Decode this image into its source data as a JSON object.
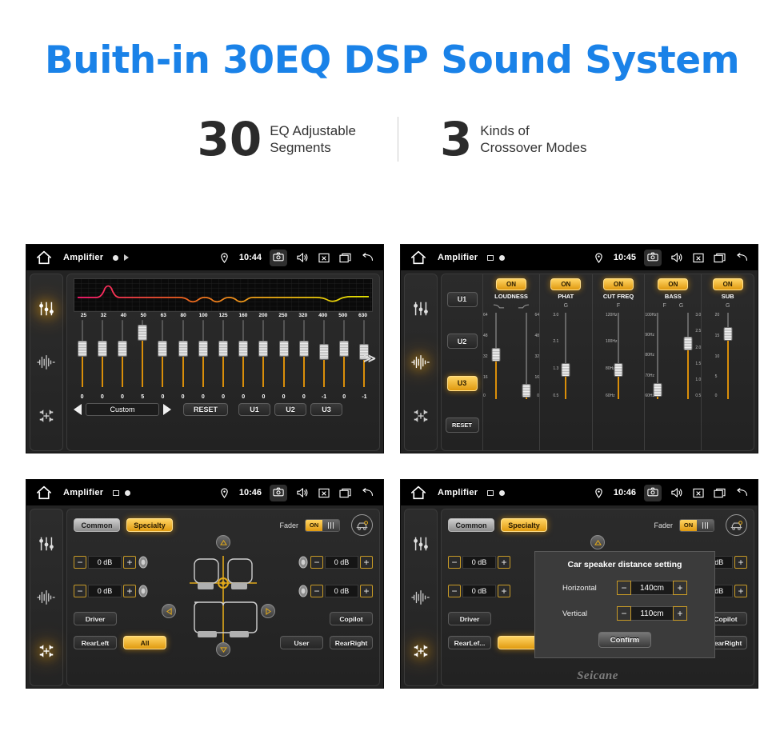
{
  "hero": {
    "title": "Buith-in 30EQ DSP Sound System",
    "stats": [
      {
        "number": "30",
        "line1": "EQ Adjustable",
        "line2": "Segments"
      },
      {
        "number": "3",
        "line1": "Kinds of",
        "line2": "Crossover Modes"
      }
    ]
  },
  "colors": {
    "title_blue": "#1a82e8",
    "amber": "#e09a10",
    "amber_light": "#ffd463",
    "panel_bg": "#232323",
    "statusbar_bg": "#000000"
  },
  "panels": [
    {
      "id": "eq-panel",
      "statusbar": {
        "title": "Amplifier",
        "time": "10:44",
        "icons": [
          "home-icon",
          "record-dot-icon",
          "play-icon",
          "location-pin-icon",
          "camera-icon",
          "volume-icon",
          "close-box-icon",
          "recent-apps-icon",
          "back-arrow-icon"
        ]
      },
      "rail": [
        {
          "icon": "eq-sliders-icon",
          "active": true
        },
        {
          "icon": "waveform-icon",
          "active": false
        },
        {
          "icon": "speaker-balance-icon",
          "active": false
        }
      ],
      "eq": {
        "frequencies": [
          "25",
          "32",
          "40",
          "50",
          "63",
          "80",
          "100",
          "125",
          "160",
          "200",
          "250",
          "320",
          "400",
          "500",
          "630"
        ],
        "values": [
          "0",
          "0",
          "0",
          "5",
          "0",
          "0",
          "0",
          "0",
          "0",
          "0",
          "0",
          "0",
          "-1",
          "0",
          "-1"
        ],
        "preset": "Custom",
        "reset_label": "RESET",
        "user_presets": [
          "U1",
          "U2",
          "U3"
        ],
        "next_label": "≫",
        "prev_arrow": "left-arrow-icon",
        "next_arrow": "right-arrow-icon"
      }
    },
    {
      "id": "crossover-panel",
      "statusbar": {
        "title": "Amplifier",
        "time": "10:45",
        "icons": [
          "home-icon",
          "image-icon",
          "record-dot-icon",
          "location-pin-icon",
          "camera-icon",
          "volume-icon",
          "close-box-icon",
          "recent-apps-icon",
          "back-arrow-icon"
        ]
      },
      "rail": [
        {
          "icon": "eq-sliders-icon",
          "active": false
        },
        {
          "icon": "waveform-icon",
          "active": true
        },
        {
          "icon": "speaker-balance-icon",
          "active": false
        }
      ],
      "presets": [
        {
          "label": "U1",
          "active": false
        },
        {
          "label": "U2",
          "active": false
        },
        {
          "label": "U3",
          "active": true
        },
        {
          "label": "RESET",
          "active": false
        }
      ],
      "columns": [
        {
          "name": "LOUDNESS",
          "state": "ON",
          "sub_labels": [
            "low-shelf-curve-icon",
            "high-shelf-curve-icon"
          ],
          "sliders": [
            {
              "scale": [
                "64",
                "48",
                "32",
                "16",
                "0"
              ],
              "value_pct": 50,
              "side": "both"
            },
            {
              "scale": [
                "64",
                "48",
                "32",
                "16",
                "0"
              ],
              "value_pct": 8,
              "side": "both"
            }
          ]
        },
        {
          "name": "PHAT",
          "state": "ON",
          "sub_labels": [
            "G"
          ],
          "sliders": [
            {
              "scale": [
                "3.0",
                "2.1",
                "1.3",
                "0.5"
              ],
              "value_pct": 32,
              "side": "left"
            }
          ]
        },
        {
          "name": "CUT FREQ",
          "state": "ON",
          "sub_labels": [
            "F"
          ],
          "sliders": [
            {
              "scale": [
                "120Hz",
                "100Hz",
                "80Hz",
                "60Hz"
              ],
              "value_pct": 32,
              "side": "left"
            }
          ]
        },
        {
          "name": "BASS",
          "state": "ON",
          "sub_labels": [
            "F",
            "G"
          ],
          "sliders": [
            {
              "scale": [
                "100Hz",
                "90Hz",
                "80Hz",
                "70Hz",
                "60Hz"
              ],
              "value_pct": 8,
              "side": "left"
            },
            {
              "scale": [
                "3.0",
                "2.5",
                "2.0",
                "1.5",
                "1.0",
                "0.5"
              ],
              "value_pct": 62,
              "side": "right"
            }
          ]
        },
        {
          "name": "SUB",
          "state": "ON",
          "sub_labels": [
            "G"
          ],
          "sliders": [
            {
              "scale": [
                "20",
                "15",
                "10",
                "5",
                "0"
              ],
              "value_pct": 74,
              "side": "left"
            }
          ]
        }
      ]
    },
    {
      "id": "fader-panel",
      "statusbar": {
        "title": "Amplifier",
        "time": "10:46",
        "icons": [
          "home-icon",
          "image-icon",
          "record-dot-icon",
          "location-pin-icon",
          "camera-icon",
          "volume-icon",
          "close-box-icon",
          "recent-apps-icon",
          "back-arrow-icon"
        ]
      },
      "rail": [
        {
          "icon": "eq-sliders-icon",
          "active": false
        },
        {
          "icon": "waveform-icon",
          "active": false
        },
        {
          "icon": "speaker-balance-icon",
          "active": true
        }
      ],
      "tabs": [
        {
          "label": "Common",
          "active": false
        },
        {
          "label": "Specialty",
          "active": true
        }
      ],
      "fader": {
        "label": "Fader",
        "state": "ON"
      },
      "car_settings_icon": "car-speaker-icon",
      "steppers": [
        {
          "position": "front-left",
          "value": "0 dB",
          "minus": "−",
          "plus": "+"
        },
        {
          "position": "front-right",
          "value": "0 dB",
          "minus": "−",
          "plus": "+"
        },
        {
          "position": "rear-left",
          "value": "0 dB",
          "minus": "−",
          "plus": "+"
        },
        {
          "position": "rear-right",
          "value": "0 dB",
          "minus": "−",
          "plus": "+"
        }
      ],
      "seat_buttons": [
        {
          "label": "Driver",
          "active": false
        },
        {
          "label": "RearLeft",
          "active": false
        },
        {
          "label": "All",
          "active": true
        },
        {
          "label": "User",
          "active": false
        },
        {
          "label": "Copilot",
          "active": false
        },
        {
          "label": "RearRight",
          "active": false
        }
      ],
      "dpad": [
        "up-arrow-icon",
        "down-arrow-icon",
        "left-arrow-icon",
        "right-arrow-icon"
      ]
    },
    {
      "id": "distance-dialog-panel",
      "statusbar": {
        "title": "Amplifier",
        "time": "10:46",
        "icons": [
          "home-icon",
          "image-icon",
          "record-dot-icon",
          "location-pin-icon",
          "camera-icon",
          "volume-icon",
          "close-box-icon",
          "recent-apps-icon",
          "back-arrow-icon"
        ]
      },
      "rail": [
        {
          "icon": "eq-sliders-icon",
          "active": false
        },
        {
          "icon": "waveform-icon",
          "active": false
        },
        {
          "icon": "speaker-balance-icon",
          "active": true
        }
      ],
      "tabs": [
        {
          "label": "Common",
          "active": false
        },
        {
          "label": "Specialty",
          "active": true
        }
      ],
      "fader": {
        "label": "Fader",
        "state": "ON"
      },
      "seat_buttons": [
        {
          "label": "Driver",
          "active": false
        },
        {
          "label": "RearLef...",
          "active": false
        },
        {
          "label": "Copilot",
          "active": false
        },
        {
          "label": "RearRight",
          "active": false
        }
      ],
      "dialog": {
        "title": "Car speaker distance setting",
        "rows": [
          {
            "label": "Horizontal",
            "value": "140cm",
            "minus": "−",
            "plus": "+"
          },
          {
            "label": "Vertical",
            "value": "110cm",
            "minus": "−",
            "plus": "+"
          }
        ],
        "confirm_label": "Confirm"
      },
      "watermark": "Seicane"
    }
  ]
}
